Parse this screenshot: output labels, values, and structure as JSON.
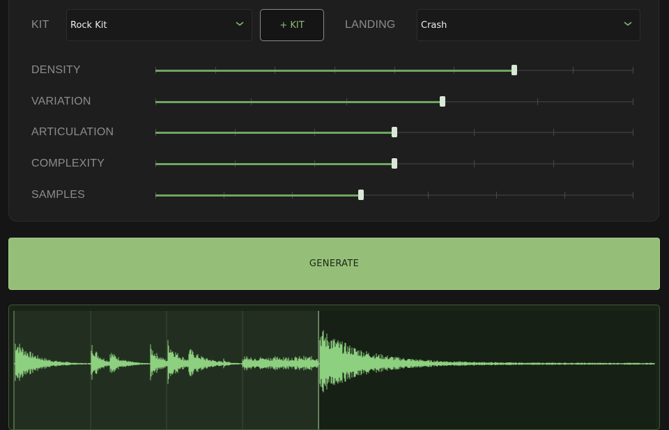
{
  "controls": {
    "kit_label": "KIT",
    "kit_value": "Rock Kit",
    "add_kit_label": "+ KIT",
    "landing_label": "LANDING",
    "landing_value": "Crash"
  },
  "sliders": [
    {
      "label": "DENSITY",
      "fraction": 0.75,
      "ticks": 9
    },
    {
      "label": "VARIATION",
      "fraction": 0.6,
      "ticks": 6
    },
    {
      "label": "ARTICULATION",
      "fraction": 0.5,
      "ticks": 7
    },
    {
      "label": "COMPLEXITY",
      "fraction": 0.5,
      "ticks": 7
    },
    {
      "label": "SAMPLES",
      "fraction": 0.43,
      "ticks": 8
    }
  ],
  "generate_label": "GENERATE",
  "waveform": {
    "playhead_fraction": 0.475,
    "accent": "#8dd07f",
    "dim": "#5f9a55"
  },
  "colors": {
    "accent": "#95bf78",
    "slider_fill": "#6ea660"
  }
}
